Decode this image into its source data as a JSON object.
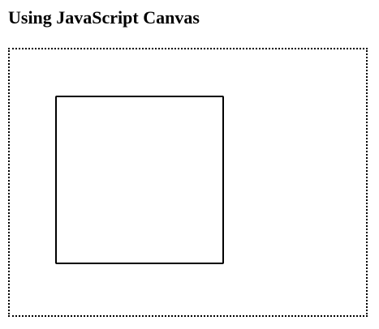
{
  "page": {
    "title": "Using JavaScript Canvas"
  },
  "canvas": {
    "shape": "stroked-square",
    "stroke_color": "#000000",
    "border_style": "dotted"
  }
}
